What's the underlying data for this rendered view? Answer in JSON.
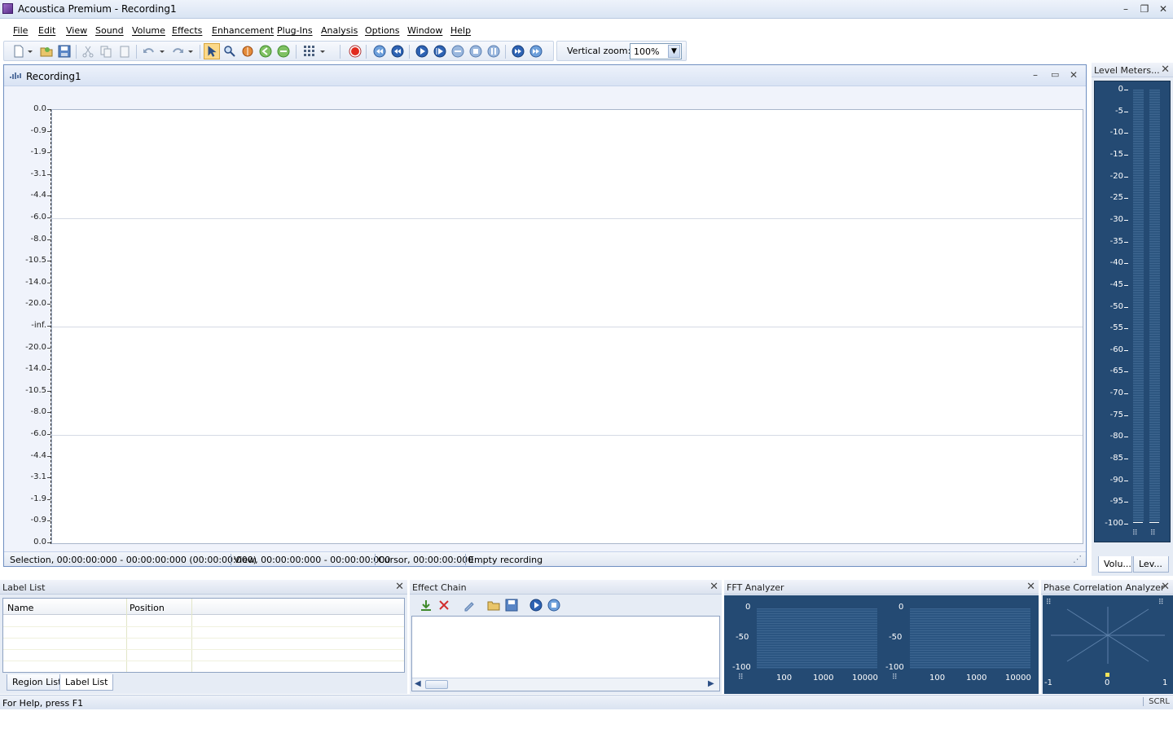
{
  "window": {
    "title": "Acoustica Premium - Recording1"
  },
  "menu": [
    "File",
    "Edit",
    "View",
    "Sound",
    "Volume",
    "Effects",
    "Enhancement",
    "Plug-Ins",
    "Analysis",
    "Options",
    "Window",
    "Help"
  ],
  "toolbar": {
    "icons": [
      "new-icon",
      "dropdown-icon",
      "open-icon",
      "save-icon",
      "cut-icon",
      "copy-icon",
      "paste-icon",
      "undo-icon",
      "redo-icon",
      "select-tool-icon",
      "zoom-tool-icon",
      "scrub-tool-icon",
      "zoom-in-icon",
      "zoom-out-icon",
      "grid-icon",
      "record-icon",
      "go-to-start-icon",
      "rewind-icon",
      "play-icon",
      "play-selection-icon",
      "loop-icon",
      "stop-icon",
      "pause-icon",
      "fast-forward-icon",
      "go-to-end-icon"
    ],
    "vertical_zoom_label": "Vertical zoom:",
    "vertical_zoom_value": "100%"
  },
  "document": {
    "title": "Recording1",
    "y_axis_ticks": [
      "0.0",
      "-0.9",
      "-1.9",
      "-3.1",
      "-4.4",
      "-6.0",
      "-8.0",
      "-10.5",
      "-14.0",
      "-20.0",
      "-inf.",
      "-20.0",
      "-14.0",
      "-10.5",
      "-8.0",
      "-6.0",
      "-4.4",
      "-3.1",
      "-1.9",
      "-0.9",
      "0.0"
    ],
    "status": {
      "selection": "Selection, 00:00:00:000 - 00:00:00:000 (00:00:00:000)",
      "view": "View, 00:00:00:000 - 00:00:00:000",
      "cursor": "Cursor, 00:00:00:000",
      "info": "Empty recording"
    }
  },
  "level_meters": {
    "title": "Level Meters...",
    "scale": [
      "0",
      "-5",
      "-10",
      "-15",
      "-20",
      "-25",
      "-30",
      "-35",
      "-40",
      "-45",
      "-50",
      "-55",
      "-60",
      "-65",
      "-70",
      "-75",
      "-80",
      "-85",
      "-90",
      "-95",
      "-100"
    ],
    "tabs": [
      "Volu...",
      "Lev..."
    ]
  },
  "label_list": {
    "title": "Label List",
    "columns": [
      "Name",
      "Position"
    ],
    "tabs": [
      "Region List",
      "Label List"
    ]
  },
  "effect_chain": {
    "title": "Effect Chain",
    "icons": [
      "download-icon",
      "delete-icon",
      "edit-icon",
      "open-icon",
      "save-icon",
      "play-icon",
      "stop-icon"
    ]
  },
  "fft": {
    "title": "FFT Analyzer",
    "y_labels": [
      "0",
      "-50",
      "-100"
    ],
    "x_labels": [
      "100",
      "1000",
      "10000"
    ]
  },
  "phase": {
    "title": "Phase Correlation Analyzer",
    "x_labels": [
      "-1",
      "0",
      "1"
    ]
  },
  "statusbar": {
    "help": "For Help, press F1",
    "scrl": "SCRL"
  },
  "colors": {
    "meter_bg": "#244a73",
    "accent": "#6f8fc1"
  }
}
